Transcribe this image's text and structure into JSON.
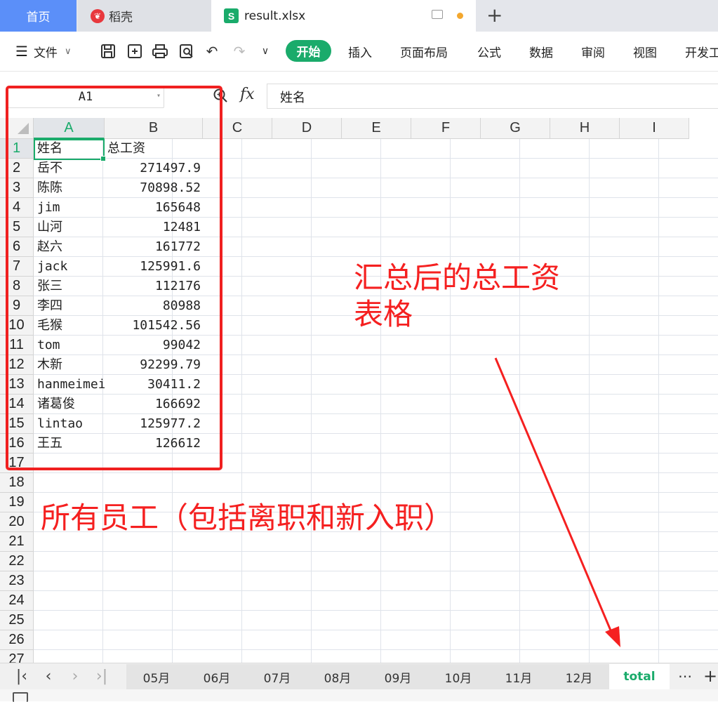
{
  "tabs": {
    "home": "首页",
    "docer": "稻壳",
    "file": "result.xlsx",
    "file_icon": "S"
  },
  "toolbar": {
    "file_menu": "文件",
    "start": "开始",
    "menus": [
      "插入",
      "页面布局",
      "公式",
      "数据",
      "审阅",
      "视图",
      "开发工"
    ]
  },
  "formula_bar": {
    "cell_ref": "A1",
    "fx": "fx",
    "content": "姓名"
  },
  "columns": [
    "A",
    "B",
    "C",
    "D",
    "E",
    "F",
    "G",
    "H",
    "I"
  ],
  "rows": [
    "1",
    "2",
    "3",
    "4",
    "5",
    "6",
    "7",
    "8",
    "9",
    "10",
    "11",
    "12",
    "13",
    "14",
    "15",
    "16",
    "17",
    "18",
    "19",
    "20",
    "21",
    "22",
    "23",
    "24",
    "25",
    "26",
    "27"
  ],
  "table": [
    {
      "name": "姓名",
      "total": "总工资"
    },
    {
      "name": "岳不",
      "total": "271497.9"
    },
    {
      "name": "陈陈",
      "total": "70898.52"
    },
    {
      "name": "jim",
      "total": "165648"
    },
    {
      "name": "山河",
      "total": "12481"
    },
    {
      "name": "赵六",
      "total": "161772"
    },
    {
      "name": "jack",
      "total": "125991.6"
    },
    {
      "name": "张三",
      "total": "112176"
    },
    {
      "name": "李四",
      "total": "80988"
    },
    {
      "name": "毛猴",
      "total": "101542.56"
    },
    {
      "name": "tom",
      "total": "99042"
    },
    {
      "name": "木新",
      "total": "92299.79"
    },
    {
      "name": "hanmeimei",
      "total": "30411.2"
    },
    {
      "name": "诸葛俊",
      "total": "166692"
    },
    {
      "name": "lintao",
      "total": "125977.2"
    },
    {
      "name": "王五",
      "total": "126612"
    }
  ],
  "annotations": {
    "summary_line1": "汇总后的总工资",
    "summary_line2": "表格",
    "employees": "所有员工（包括离职和新入职）"
  },
  "sheets": [
    "05月",
    "06月",
    "07月",
    "08月",
    "09月",
    "10月",
    "11月",
    "12月",
    "total"
  ],
  "active_sheet": "total",
  "colors": {
    "accent": "#1aab6b",
    "annotation": "#f52020",
    "home_tab": "#5b8ff9"
  }
}
